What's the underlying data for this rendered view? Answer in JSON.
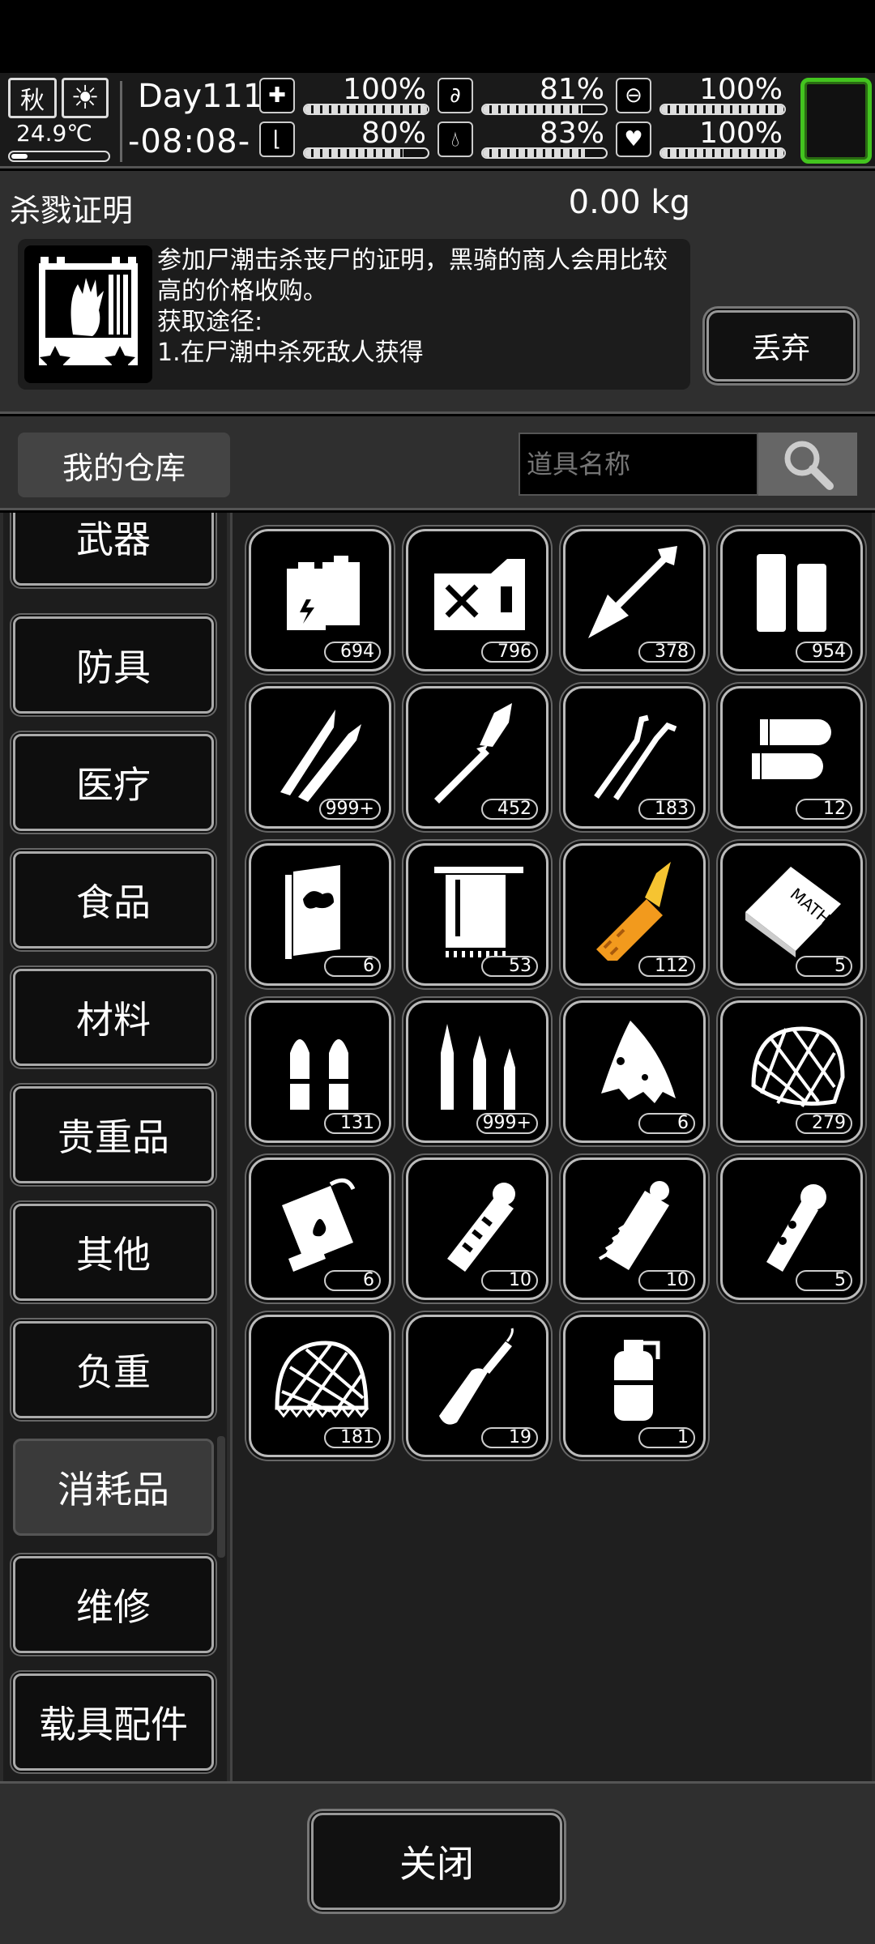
{
  "hud": {
    "season": "秋",
    "temperature": "24.9℃",
    "day": "Day111",
    "time": "-08:08-",
    "stats": [
      {
        "icon": "medkit-icon",
        "value": "100%",
        "level": 1.0
      },
      {
        "icon": "stomach-icon",
        "value": "81%",
        "level": 0.81
      },
      {
        "icon": "pill-icon",
        "value": "100%",
        "level": 1.0
      },
      {
        "icon": "boot-icon",
        "value": "80%",
        "level": 0.8
      },
      {
        "icon": "water-drop-icon",
        "value": "83%",
        "level": 0.83
      },
      {
        "icon": "heart-icon",
        "value": "100%",
        "level": 1.0
      }
    ]
  },
  "item": {
    "name": "杀戮证明",
    "weight": "0.00 kg",
    "description": "参加尸潮击杀丧尸的证明，黑骑的商人会用比较\n高的价格收购。\n获取途径:\n1.在尸潮中杀死敌人获得",
    "discard_label": "丢弃"
  },
  "storage": {
    "title": "我的仓库",
    "search_placeholder": "道具名称"
  },
  "categories": [
    "武器",
    "防具",
    "医疗",
    "食品",
    "材料",
    "贵重品",
    "其他",
    "负重",
    "消耗品",
    "维修",
    "载具配件"
  ],
  "active_category": "消耗品",
  "items": [
    {
      "icon": "battery-icon",
      "count": "694"
    },
    {
      "icon": "jerry-can-icon",
      "count": "796"
    },
    {
      "icon": "arrow-icon",
      "count": "378"
    },
    {
      "icon": "shotgun-shells-icon",
      "count": "954"
    },
    {
      "icon": "rifle-bullets-icon",
      "count": "999+"
    },
    {
      "icon": "rocket-round-icon",
      "count": "452"
    },
    {
      "icon": "lockpick-icon",
      "count": "183"
    },
    {
      "icon": "pistol-ammo-icon",
      "count": "12"
    },
    {
      "icon": "book-icon",
      "count": "6"
    },
    {
      "icon": "towel-icon",
      "count": "53"
    },
    {
      "icon": "syringe-icon",
      "count": "112"
    },
    {
      "icon": "math-book-icon",
      "count": "5"
    },
    {
      "icon": "bullets-pair-icon",
      "count": "131"
    },
    {
      "icon": "mixed-bullets-icon",
      "count": "999+"
    },
    {
      "icon": "torn-cloth-icon",
      "count": "6"
    },
    {
      "icon": "net-bag-icon",
      "count": "279"
    },
    {
      "icon": "incendiary-grenade-icon",
      "count": "6"
    },
    {
      "icon": "flashbang-icon",
      "count": "10"
    },
    {
      "icon": "stun-grenade-icon",
      "count": "10"
    },
    {
      "icon": "frag-grenade-icon",
      "count": "5"
    },
    {
      "icon": "net-icon",
      "count": "181"
    },
    {
      "icon": "molotov-icon",
      "count": "19"
    },
    {
      "icon": "smoke-grenade-icon",
      "count": "1"
    }
  ],
  "close_label": "关闭",
  "colors": {
    "accent_green": "#43c41f",
    "badge_border": "#cccccc",
    "syringe_orange": "#f29a1d"
  }
}
